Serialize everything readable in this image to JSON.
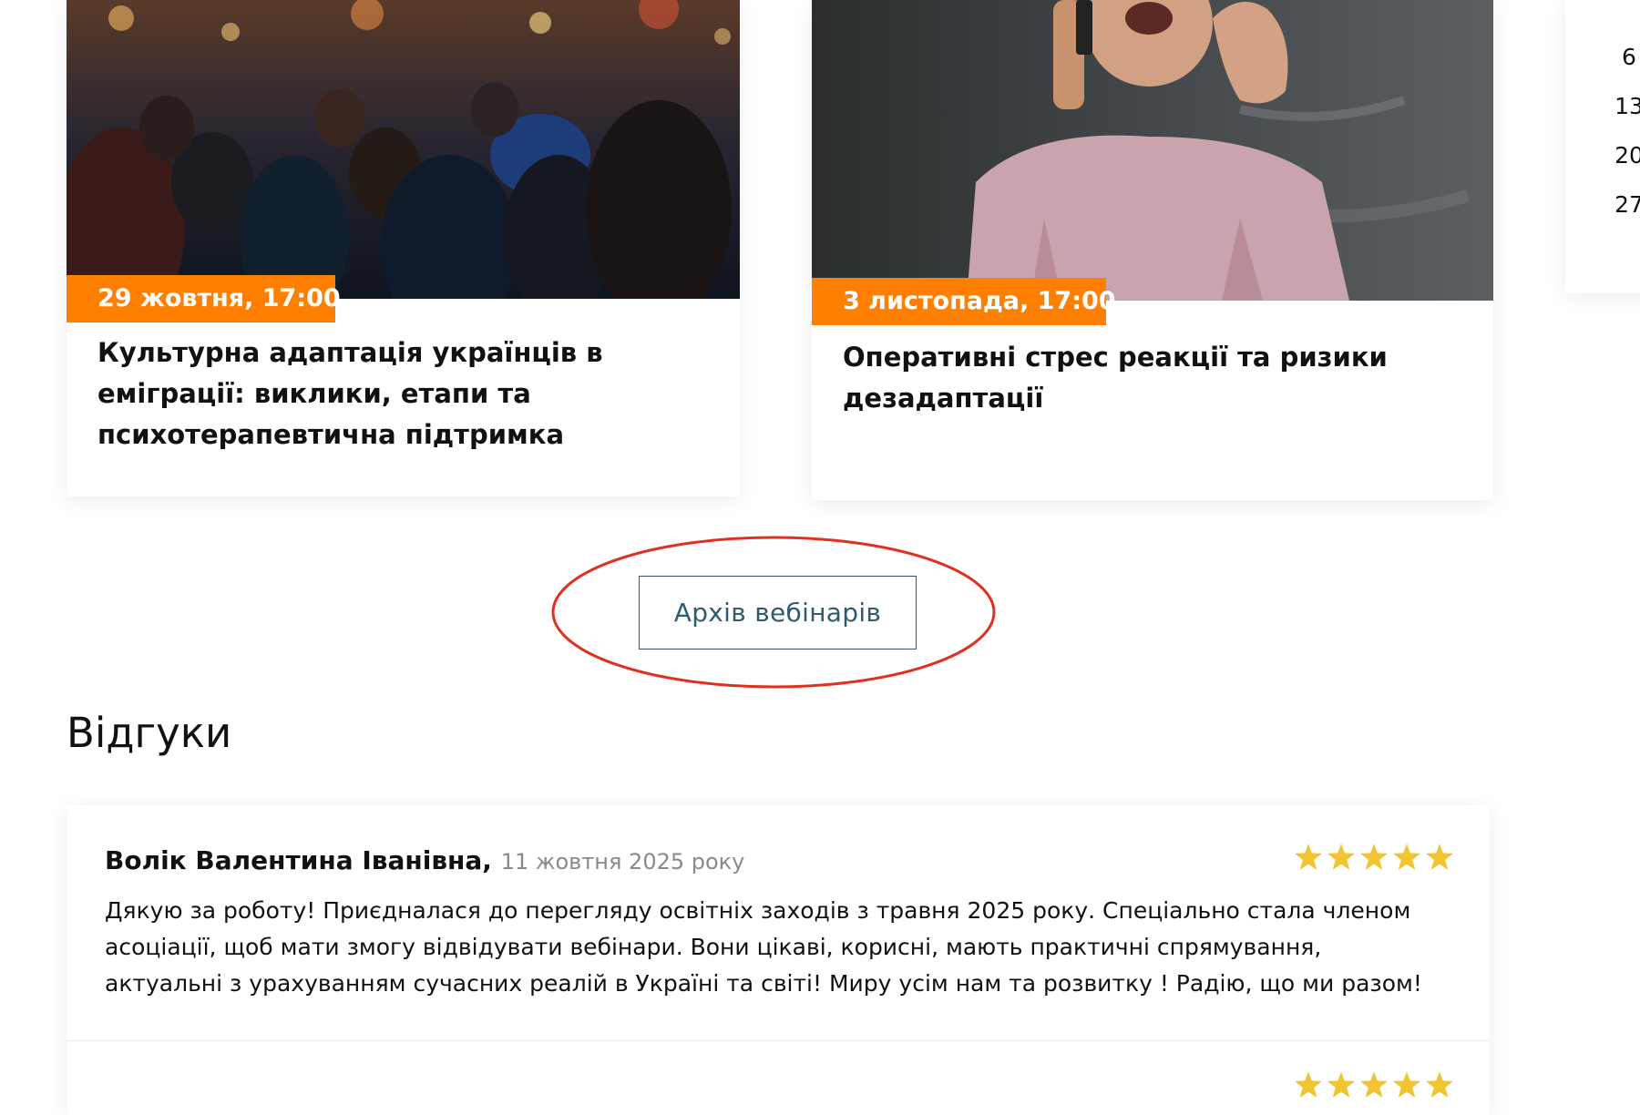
{
  "webinars": [
    {
      "date": "29 жовтня, 17:00",
      "title": "Культурна адаптація українців в еміграції: виклики, етапи та психотерапевтична підтримка",
      "image_icon": "crowd-night-photo"
    },
    {
      "date": "3 листопада, 17:00",
      "title": "Оперативні стрес реакції та ризики дезадаптації",
      "image_icon": "stressed-man-phone-photo"
    }
  ],
  "calendar": {
    "days": [
      "6",
      "13",
      "20",
      "27"
    ]
  },
  "archive_button": {
    "label": "Архів вебінарів"
  },
  "annotation_color": "#e03020",
  "accent_color": "#ff7f00",
  "reviews": {
    "title": "Відгуки",
    "items": [
      {
        "author": "Волік Валентина Іванівна",
        "date": "11 жовтня 2025 року",
        "rating": 5,
        "text": "Дякую за роботу! Приєдналася до перегляду освітніх заходів  з травня 2025 року. Спеціально стала членом асоціації, щоб мати змогу відвідувати вебінари. Вони цікаві, корисні, мають практичні спрямування, актуальні з урахуванням сучасних реалій в Україні та світі! Миру усім нам та розвитку ! Радію, що ми разом!"
      },
      {
        "rating": 5
      }
    ]
  }
}
